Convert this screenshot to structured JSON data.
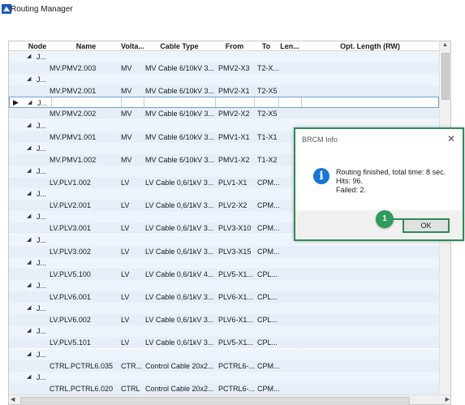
{
  "window": {
    "title": "Routing Manager"
  },
  "grid": {
    "columns": [
      "Node",
      "Name",
      "Volta...",
      "Cable Type",
      "From",
      "To",
      "Len...",
      "Opt. Length (RW)"
    ],
    "rows": [
      {
        "node": "J...",
        "name": "MV.PMV2.003",
        "voltage": "MV",
        "cable_type": "MV Cable 6/10kV 3...",
        "from": "PMV2-X3",
        "to": "T2-X..."
      },
      {
        "node": "J...",
        "name": "MV.PMV2.001",
        "voltage": "MV",
        "cable_type": "MV Cable 6/10kV 3...",
        "from": "PMV2-X1",
        "to": "T2-X5"
      },
      {
        "node": "J...",
        "name": "MV.PMV2.002",
        "voltage": "MV",
        "cable_type": "MV Cable 6/10kV 3...",
        "from": "PMV2-X2",
        "to": "T2-X5"
      },
      {
        "node": "J...",
        "name": "MV.PMV1.001",
        "voltage": "MV",
        "cable_type": "MV Cable 6/10kV 3...",
        "from": "PMV1-X1",
        "to": "T1-X1"
      },
      {
        "node": "J...",
        "name": "MV.PMV1.002",
        "voltage": "MV",
        "cable_type": "MV Cable 6/10kV 3...",
        "from": "PMV1-X2",
        "to": "T1-X2"
      },
      {
        "node": "J...",
        "name": "LV.PLV1.002",
        "voltage": "LV",
        "cable_type": "LV Cable 0,6/1kV 3...",
        "from": "PLV1-X1",
        "to": "CPM..."
      },
      {
        "node": "J...",
        "name": "LV.PLV2.001",
        "voltage": "LV",
        "cable_type": "LV Cable 0,6/1kV 3...",
        "from": "PLV2-X2",
        "to": "CPM..."
      },
      {
        "node": "J...",
        "name": "LV.PLV3.001",
        "voltage": "LV",
        "cable_type": "LV Cable 0,6/1kV 3...",
        "from": "PLV3-X10",
        "to": "CPM..."
      },
      {
        "node": "J...",
        "name": "LV.PLV3.002",
        "voltage": "LV",
        "cable_type": "LV Cable 0,6/1kV 3...",
        "from": "PLV3-X15",
        "to": "CPM..."
      },
      {
        "node": "J...",
        "name": "LV.PLV5.100",
        "voltage": "LV",
        "cable_type": "LV Cable 0,6/1kV 4...",
        "from": "PLV5-X1...",
        "to": "CPL..."
      },
      {
        "node": "J...",
        "name": "LV.PLV6.001",
        "voltage": "LV",
        "cable_type": "LV Cable 0,6/1kV 3...",
        "from": "PLV6-X1...",
        "to": "CPL..."
      },
      {
        "node": "J...",
        "name": "LV.PLV6.002",
        "voltage": "LV",
        "cable_type": "LV Cable 0,6/1kV 3...",
        "from": "PLV6-X1...",
        "to": "CPL..."
      },
      {
        "node": "J...",
        "name": "LV.PLV5.101",
        "voltage": "LV",
        "cable_type": "LV Cable 0,6/1kV 3...",
        "from": "PLV5-X1...",
        "to": "CPL..."
      },
      {
        "node": "J...",
        "name": "CTRL.PCTRL6.035",
        "voltage": "CTR...",
        "cable_type": "Control Cable 20x2...",
        "from": "PCTRL6-...",
        "to": "CPM..."
      },
      {
        "node": "J...",
        "name": "CTRL.PCTRL6.020",
        "voltage": "CTRL",
        "cable_type": "Control Cable 20x2...",
        "from": "PCTRL6-...",
        "to": "CPM..."
      }
    ]
  },
  "dialog": {
    "title": "BRCM Info",
    "message_line1": "Routing finished, total time:  8 sec.",
    "message_line2": "Hits: 96.",
    "message_line3": "Failed: 2.",
    "ok_label": "OK"
  },
  "annotation": {
    "step": "1"
  },
  "colors": {
    "highlight": "#2e8b57",
    "info": "#1976d2",
    "row_bg": "#e6eef8"
  }
}
